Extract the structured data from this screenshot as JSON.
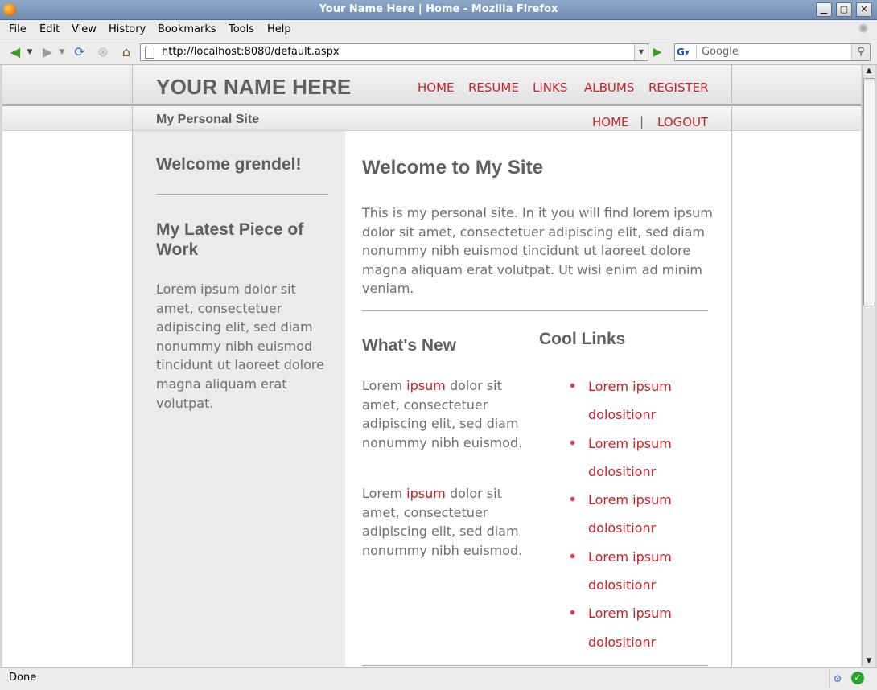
{
  "window": {
    "title": "Your Name Here | Home - Mozilla Firefox"
  },
  "menubar": {
    "items": [
      "File",
      "Edit",
      "View",
      "History",
      "Bookmarks",
      "Tools",
      "Help"
    ]
  },
  "navbar": {
    "url": "http://localhost:8080/default.aspx",
    "search_placeholder": "Google"
  },
  "site": {
    "title": "YOUR NAME HERE",
    "subtitle": "My Personal Site",
    "topnav": [
      "HOME",
      "RESUME",
      "LINKS",
      "ALBUMS",
      "REGISTER"
    ],
    "subnav": {
      "home": "HOME",
      "sep": "|",
      "logout": "LOGOUT"
    }
  },
  "sidebar": {
    "welcome": "Welcome grendel!",
    "work_heading_1": "My Latest Piece of",
    "work_heading_2": "Work",
    "work_text": "Lorem ipsum dolor sit amet, consectetuer adipiscing elit, sed diam nonummy nibh euismod tincidunt ut laoreet dolore magna aliquam erat volutpat."
  },
  "main": {
    "heading": "Welcome to My Site",
    "intro": "This is my personal site. In it you will find lorem ipsum dolor sit amet, consectetuer adipiscing elit, sed diam nonummy nibh euismod tincidunt ut laoreet dolore magna aliquam erat volutpat. Ut wisi enim ad minim veniam.",
    "whats_new": {
      "heading": "What's New",
      "items": [
        {
          "lead": "Lorem",
          "link": "ipsum",
          "rest": "dolor sit amet, consectetuer adipiscing elit, sed diam nonummy nibh euismod."
        },
        {
          "lead": "Lorem",
          "link": "ipsum",
          "rest": "dolor sit amet, consectetuer adipiscing elit, sed diam nonummy nibh euismod."
        }
      ]
    },
    "cool_links": {
      "heading": "Cool Links",
      "items": [
        "Lorem ipsum dolositionr",
        "Lorem ipsum dolositionr",
        "Lorem ipsum dolositionr",
        "Lorem ipsum dolositionr",
        "Lorem ipsum dolositionr"
      ]
    }
  },
  "statusbar": {
    "text": "Done"
  },
  "colors": {
    "accent": "#c8202a",
    "text_gray": "#6f6f6f",
    "heading_gray": "#5f5f5f",
    "sidebar_bg": "#ebebeb"
  }
}
